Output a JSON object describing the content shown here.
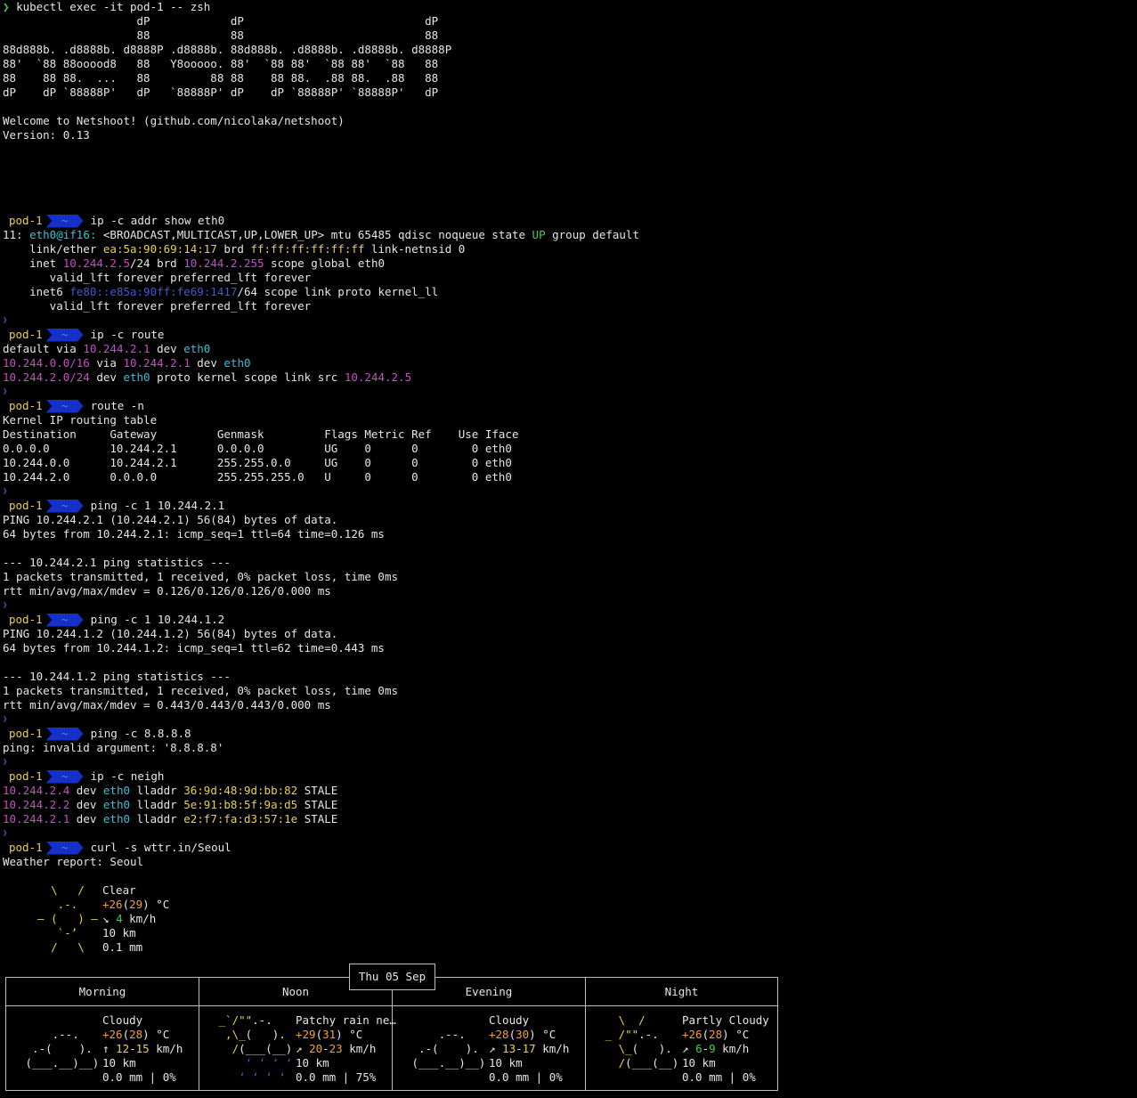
{
  "cmd": "kubectl exec -it pod-1 -- zsh",
  "cmd_prefix": "❯",
  "banner": [
    "                    dP            dP                           dP",
    "                    88            88                           88",
    "88d888b. .d8888b. d8888P .d8888b. 88d888b. .d8888b. .d8888b. d8888P",
    "88'  `88 88ooood8   88   Y8ooooo. 88'  `88 88'  `88 88'  `88   88",
    "88    88 88.  ...   88         88 88    88 88.  .88 88.  .88   88",
    "dP    dP `88888P'   dP   `88888P' dP    dP `88888P' `88888P'   dP"
  ],
  "welcome": "Welcome to Netshoot! (github.com/nicolaka/netshoot)",
  "version": "Version: 0.13",
  "prompt": {
    "pod": "pod-1",
    "dir": "~",
    "marker": "❯"
  },
  "sessions": [
    {
      "cmd": "ip -c addr show eth0",
      "lines": [
        [
          [
            "w",
            "11: "
          ],
          [
            "cyan",
            "eth0@if16: "
          ],
          [
            "w",
            "<BROADCAST,MULTICAST,UP,LOWER_UP> mtu 65485 qdisc noqueue state "
          ],
          [
            "grn",
            "UP"
          ],
          [
            "w",
            " group default"
          ]
        ],
        [
          [
            "w",
            "    link/ether "
          ],
          [
            "yel",
            "ea:5a:90:69:14:17"
          ],
          [
            "w",
            " brd "
          ],
          [
            "yel",
            "ff:ff:ff:ff:ff:ff"
          ],
          [
            "w",
            " link-netnsid 0"
          ]
        ],
        [
          [
            "w",
            "    inet "
          ],
          [
            "mag",
            "10.244.2.5"
          ],
          [
            "w",
            "/24 brd "
          ],
          [
            "mag",
            "10.244.2.255"
          ],
          [
            "w",
            " scope global eth0"
          ]
        ],
        [
          [
            "w",
            "       valid_lft forever preferred_lft forever"
          ]
        ],
        [
          [
            "w",
            "    inet6 "
          ],
          [
            "blu",
            "fe80::e85a:90ff:fe69:1417"
          ],
          [
            "w",
            "/64 scope link proto kernel_ll"
          ]
        ],
        [
          [
            "w",
            "       valid_lft forever preferred_lft forever"
          ]
        ]
      ]
    },
    {
      "cmd": "ip -c route",
      "lines": [
        [
          [
            "w",
            "default via "
          ],
          [
            "mag",
            "10.244.2.1"
          ],
          [
            "w",
            " dev "
          ],
          [
            "cyan",
            "eth0"
          ]
        ],
        [
          [
            "mag",
            "10.244.0.0/16"
          ],
          [
            "w",
            " via "
          ],
          [
            "mag",
            "10.244.2.1"
          ],
          [
            "w",
            " dev "
          ],
          [
            "cyan",
            "eth0"
          ]
        ],
        [
          [
            "mag",
            "10.244.2.0/24"
          ],
          [
            "w",
            " dev "
          ],
          [
            "cyan",
            "eth0"
          ],
          [
            "w",
            " proto kernel scope link src "
          ],
          [
            "mag",
            "10.244.2.5"
          ]
        ]
      ]
    },
    {
      "cmd": "route -n",
      "lines": [
        [
          [
            "w",
            "Kernel IP routing table"
          ]
        ],
        [
          [
            "w",
            "Destination     Gateway         Genmask         Flags Metric Ref    Use Iface"
          ]
        ],
        [
          [
            "w",
            "0.0.0.0         10.244.2.1      0.0.0.0         UG    0      0        0 eth0"
          ]
        ],
        [
          [
            "w",
            "10.244.0.0      10.244.2.1      255.255.0.0     UG    0      0        0 eth0"
          ]
        ],
        [
          [
            "w",
            "10.244.2.0      0.0.0.0         255.255.255.0   U     0      0        0 eth0"
          ]
        ]
      ]
    },
    {
      "cmd": "ping -c 1 10.244.2.1",
      "lines": [
        [
          [
            "w",
            "PING 10.244.2.1 (10.244.2.1) 56(84) bytes of data."
          ]
        ],
        [
          [
            "w",
            "64 bytes from 10.244.2.1: icmp_seq=1 ttl=64 time=0.126 ms"
          ]
        ],
        [],
        [
          [
            "w",
            "--- 10.244.2.1 ping statistics ---"
          ]
        ],
        [
          [
            "w",
            "1 packets transmitted, 1 received, 0% packet loss, time 0ms"
          ]
        ],
        [
          [
            "w",
            "rtt min/avg/max/mdev = 0.126/0.126/0.126/0.000 ms"
          ]
        ]
      ]
    },
    {
      "cmd": "ping -c 1 10.244.1.2",
      "lines": [
        [
          [
            "w",
            "PING 10.244.1.2 (10.244.1.2) 56(84) bytes of data."
          ]
        ],
        [
          [
            "w",
            "64 bytes from 10.244.1.2: icmp_seq=1 ttl=62 time=0.443 ms"
          ]
        ],
        [],
        [
          [
            "w",
            "--- 10.244.1.2 ping statistics ---"
          ]
        ],
        [
          [
            "w",
            "1 packets transmitted, 1 received, 0% packet loss, time 0ms"
          ]
        ],
        [
          [
            "w",
            "rtt min/avg/max/mdev = 0.443/0.443/0.443/0.000 ms"
          ]
        ]
      ]
    },
    {
      "cmd": "ping -c 8.8.8.8",
      "lines": [
        [
          [
            "w",
            "ping: invalid argument: '8.8.8.8'"
          ]
        ]
      ]
    },
    {
      "cmd": "ip -c neigh",
      "lines": [
        [
          [
            "mag",
            "10.244.2.4"
          ],
          [
            "w",
            " dev "
          ],
          [
            "cyan",
            "eth0"
          ],
          [
            "w",
            " lladdr "
          ],
          [
            "yel",
            "36:9d:48:9d:bb:82"
          ],
          [
            "w",
            " STALE"
          ]
        ],
        [
          [
            "mag",
            "10.244.2.2"
          ],
          [
            "w",
            " dev "
          ],
          [
            "cyan",
            "eth0"
          ],
          [
            "w",
            " lladdr "
          ],
          [
            "yel",
            "5e:91:b8:5f:9a:d5"
          ],
          [
            "w",
            " STALE"
          ]
        ],
        [
          [
            "mag",
            "10.244.2.1"
          ],
          [
            "w",
            " dev "
          ],
          [
            "cyan",
            "eth0"
          ],
          [
            "w",
            " lladdr "
          ],
          [
            "yel",
            "e2:f7:fa:d3:57:1e"
          ],
          [
            "w",
            " STALE"
          ]
        ]
      ]
    }
  ],
  "weather": {
    "cmd": "curl -s wttr.in/Seoul",
    "title": "Weather report: Seoul",
    "icon": [
      [
        [
          "yel",
          "    \\   /    "
        ]
      ],
      [
        [
          "yel",
          "     .-.     "
        ]
      ],
      [
        [
          "yel",
          "  ― (   ) ―  "
        ]
      ],
      [
        [
          "yel",
          "     `-’     "
        ]
      ],
      [
        [
          "yel",
          "    /   \\    "
        ]
      ]
    ],
    "text": [
      [
        [
          "w",
          "Clear"
        ]
      ],
      [
        [
          "ora",
          "+26"
        ],
        [
          "w",
          "("
        ],
        [
          "ora",
          "29"
        ],
        [
          "w",
          ") °C"
        ]
      ],
      [
        [
          "w",
          "↘ "
        ],
        [
          "grn",
          "4"
        ],
        [
          "w",
          " km/h"
        ]
      ],
      [
        [
          "w",
          "10 km"
        ]
      ],
      [
        [
          "w",
          "0.1 mm"
        ]
      ]
    ],
    "day_label": "Thu 05 Sep",
    "periods": [
      {
        "name": "Morning",
        "icon": [
          [
            [
              "w",
              "             "
            ]
          ],
          [
            [
              "w",
              "     .--.    "
            ]
          ],
          [
            [
              "w",
              "  .-(    ).  "
            ]
          ],
          [
            [
              "w",
              " (___.__)__) "
            ]
          ],
          [
            [
              "w",
              "             "
            ]
          ]
        ],
        "text": [
          [
            [
              "w",
              "Cloudy"
            ]
          ],
          [
            [
              "ora",
              "+26"
            ],
            [
              "w",
              "("
            ],
            [
              "ora",
              "28"
            ],
            [
              "w",
              ") °C"
            ]
          ],
          [
            [
              "w",
              "↑ "
            ],
            [
              "yel",
              "12"
            ],
            [
              "w",
              "-"
            ],
            [
              "yel",
              "15"
            ],
            [
              "w",
              " km/h"
            ]
          ],
          [
            [
              "w",
              "10 km"
            ]
          ],
          [
            [
              "w",
              "0.0 mm | 0%"
            ]
          ]
        ]
      },
      {
        "name": "Noon",
        "icon": [
          [
            [
              "yel",
              " _`/\"\""
            ],
            [
              "w",
              ".-.    "
            ]
          ],
          [
            [
              "yel",
              "  ,\\_"
            ],
            [
              "w",
              "(   ).  "
            ]
          ],
          [
            [
              "yel",
              "   /"
            ],
            [
              "w",
              "(___(__) "
            ]
          ],
          [
            [
              "blu",
              "     ‘ ‘ ‘ ‘ "
            ]
          ],
          [
            [
              "blu",
              "    ‘ ‘ ‘ ‘  "
            ]
          ]
        ],
        "text": [
          [
            [
              "w",
              "Patchy rain ne…"
            ]
          ],
          [
            [
              "ora",
              "+29"
            ],
            [
              "w",
              "("
            ],
            [
              "ora",
              "31"
            ],
            [
              "w",
              ") °C"
            ]
          ],
          [
            [
              "w",
              "↗ "
            ],
            [
              "ora",
              "20"
            ],
            [
              "w",
              "-"
            ],
            [
              "ora",
              "23"
            ],
            [
              "w",
              " km/h"
            ]
          ],
          [
            [
              "w",
              "10 km"
            ]
          ],
          [
            [
              "w",
              "0.0 mm | 75%"
            ]
          ]
        ]
      },
      {
        "name": "Evening",
        "icon": [
          [
            [
              "w",
              "             "
            ]
          ],
          [
            [
              "w",
              "     .--.    "
            ]
          ],
          [
            [
              "w",
              "  .-(    ).  "
            ]
          ],
          [
            [
              "w",
              " (___.__)__) "
            ]
          ],
          [
            [
              "w",
              "             "
            ]
          ]
        ],
        "text": [
          [
            [
              "w",
              "Cloudy"
            ]
          ],
          [
            [
              "ora",
              "+28"
            ],
            [
              "w",
              "("
            ],
            [
              "ora",
              "30"
            ],
            [
              "w",
              ") °C"
            ]
          ],
          [
            [
              "w",
              "↗ "
            ],
            [
              "yel",
              "13"
            ],
            [
              "w",
              "-"
            ],
            [
              "yel",
              "17"
            ],
            [
              "w",
              " km/h"
            ]
          ],
          [
            [
              "w",
              "10 km"
            ]
          ],
          [
            [
              "w",
              "0.0 mm | 0%"
            ]
          ]
        ]
      },
      {
        "name": "Night",
        "icon": [
          [
            [
              "yel",
              "   \\  /      "
            ]
          ],
          [
            [
              "yel",
              " _ /\"\""
            ],
            [
              "w",
              ".-.    "
            ]
          ],
          [
            [
              "yel",
              "   \\_"
            ],
            [
              "w",
              "(   ).  "
            ]
          ],
          [
            [
              "yel",
              "   /"
            ],
            [
              "w",
              "(___(__) "
            ]
          ],
          [
            [
              "w",
              "             "
            ]
          ]
        ],
        "text": [
          [
            [
              "w",
              "Partly Cloudy"
            ]
          ],
          [
            [
              "ora",
              "+26"
            ],
            [
              "w",
              "("
            ],
            [
              "ora",
              "28"
            ],
            [
              "w",
              ") °C"
            ]
          ],
          [
            [
              "w",
              "↗ "
            ],
            [
              "grn",
              "6"
            ],
            [
              "w",
              "-"
            ],
            [
              "grn",
              "9"
            ],
            [
              "w",
              " km/h"
            ]
          ],
          [
            [
              "w",
              "10 km"
            ]
          ],
          [
            [
              "w",
              "0.0 mm | 0%"
            ]
          ]
        ]
      }
    ]
  }
}
